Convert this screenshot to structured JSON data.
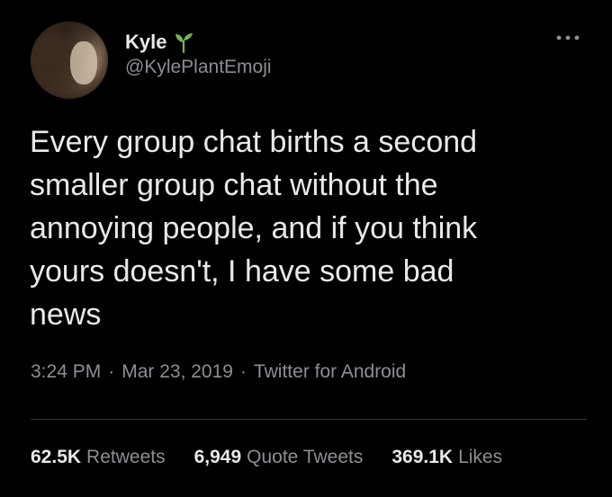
{
  "author": {
    "name": "Kyle",
    "handle": "@KylePlantEmoji",
    "name_badge_icon": "sprout-icon"
  },
  "tweet": {
    "text": "Every group chat births a second\nsmaller group chat without the\nannoying people, and if you think\nyours doesn't, I have some bad\nnews"
  },
  "meta": {
    "time": "3:24 PM",
    "separator": "·",
    "date": "Mar 23, 2019",
    "source": "Twitter for Android"
  },
  "stats": {
    "retweets_count": "62.5K",
    "retweets_label": "Retweets",
    "quotes_count": "6,949",
    "quotes_label": "Quote Tweets",
    "likes_count": "369.1K",
    "likes_label": "Likes"
  },
  "colors": {
    "background": "#000000",
    "primary_text": "#e7e9ea",
    "secondary_text": "#8b8f93",
    "sprout_green": "#77b255",
    "divider": "#2f3336"
  }
}
